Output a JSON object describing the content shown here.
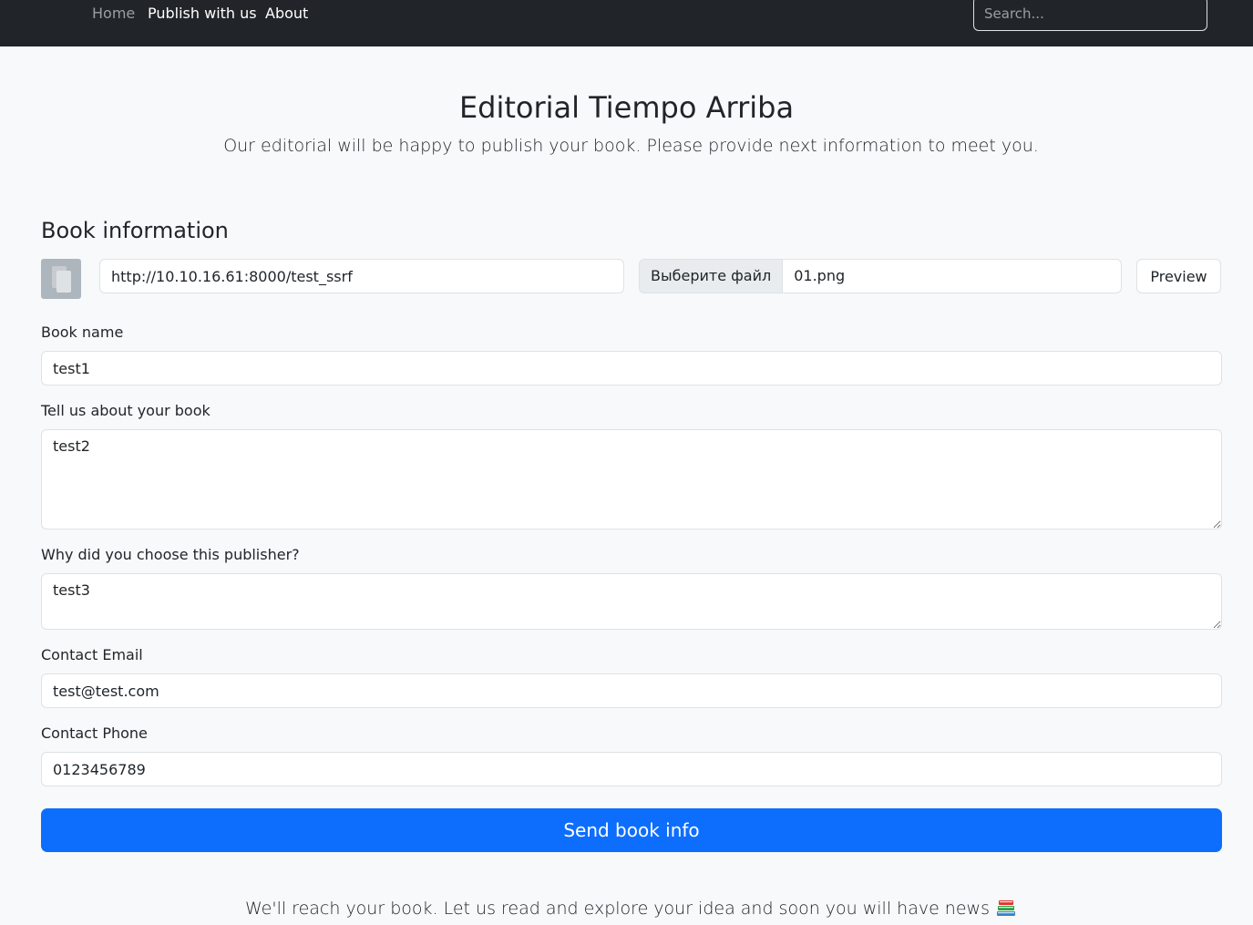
{
  "nav": {
    "home": "Home",
    "publish": "Publish with us",
    "about": "About",
    "search_placeholder": "Search..."
  },
  "hero": {
    "title": "Editorial Tiempo Arriba",
    "subtitle": "Our editorial will be happy to publish your book. Please provide next information to meet you."
  },
  "book_info": {
    "title": "Book information",
    "cover_url": "http://10.10.16.61:8000/test_ssrf",
    "file_button": "Выберите файл",
    "file_name": "01.png",
    "preview_label": "Preview"
  },
  "form": {
    "book_name_label": "Book name",
    "book_name_value": "test1",
    "about_label": "Tell us about your book",
    "about_value": "test2",
    "why_label": "Why did you choose this publisher?",
    "why_value": "test3",
    "email_label": "Contact Email",
    "email_value": "test@test.com",
    "phone_label": "Contact Phone",
    "phone_value": "0123456789",
    "submit_label": "Send book info"
  },
  "footer": {
    "note": "We'll reach your book. Let us read and explore your idea and soon you will have news"
  },
  "colors": {
    "navbar": "#212529",
    "page_bg": "#f8f9fa",
    "primary": "#0d6efd",
    "border": "#dee2e6"
  }
}
